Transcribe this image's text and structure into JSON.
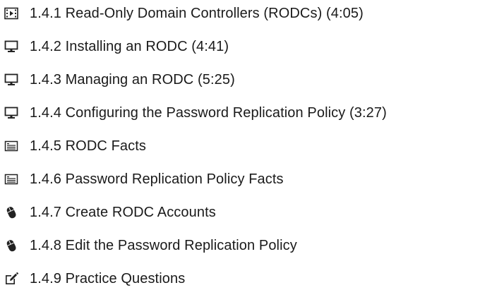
{
  "lessons": [
    {
      "icon": "video-icon",
      "label": "1.4.1 Read-Only Domain Controllers (RODCs) (4:05)"
    },
    {
      "icon": "monitor-icon",
      "label": "1.4.2 Installing an RODC (4:41)"
    },
    {
      "icon": "monitor-icon",
      "label": "1.4.3 Managing an RODC (5:25)"
    },
    {
      "icon": "monitor-icon",
      "label": "1.4.4 Configuring the Password Replication Policy (3:27)"
    },
    {
      "icon": "document-icon",
      "label": "1.4.5 RODC Facts"
    },
    {
      "icon": "document-icon",
      "label": "1.4.6 Password Replication Policy Facts"
    },
    {
      "icon": "mouse-icon",
      "label": "1.4.7 Create RODC Accounts"
    },
    {
      "icon": "mouse-icon",
      "label": "1.4.8 Edit the Password Replication Policy"
    },
    {
      "icon": "edit-icon",
      "label": "1.4.9 Practice Questions"
    }
  ]
}
